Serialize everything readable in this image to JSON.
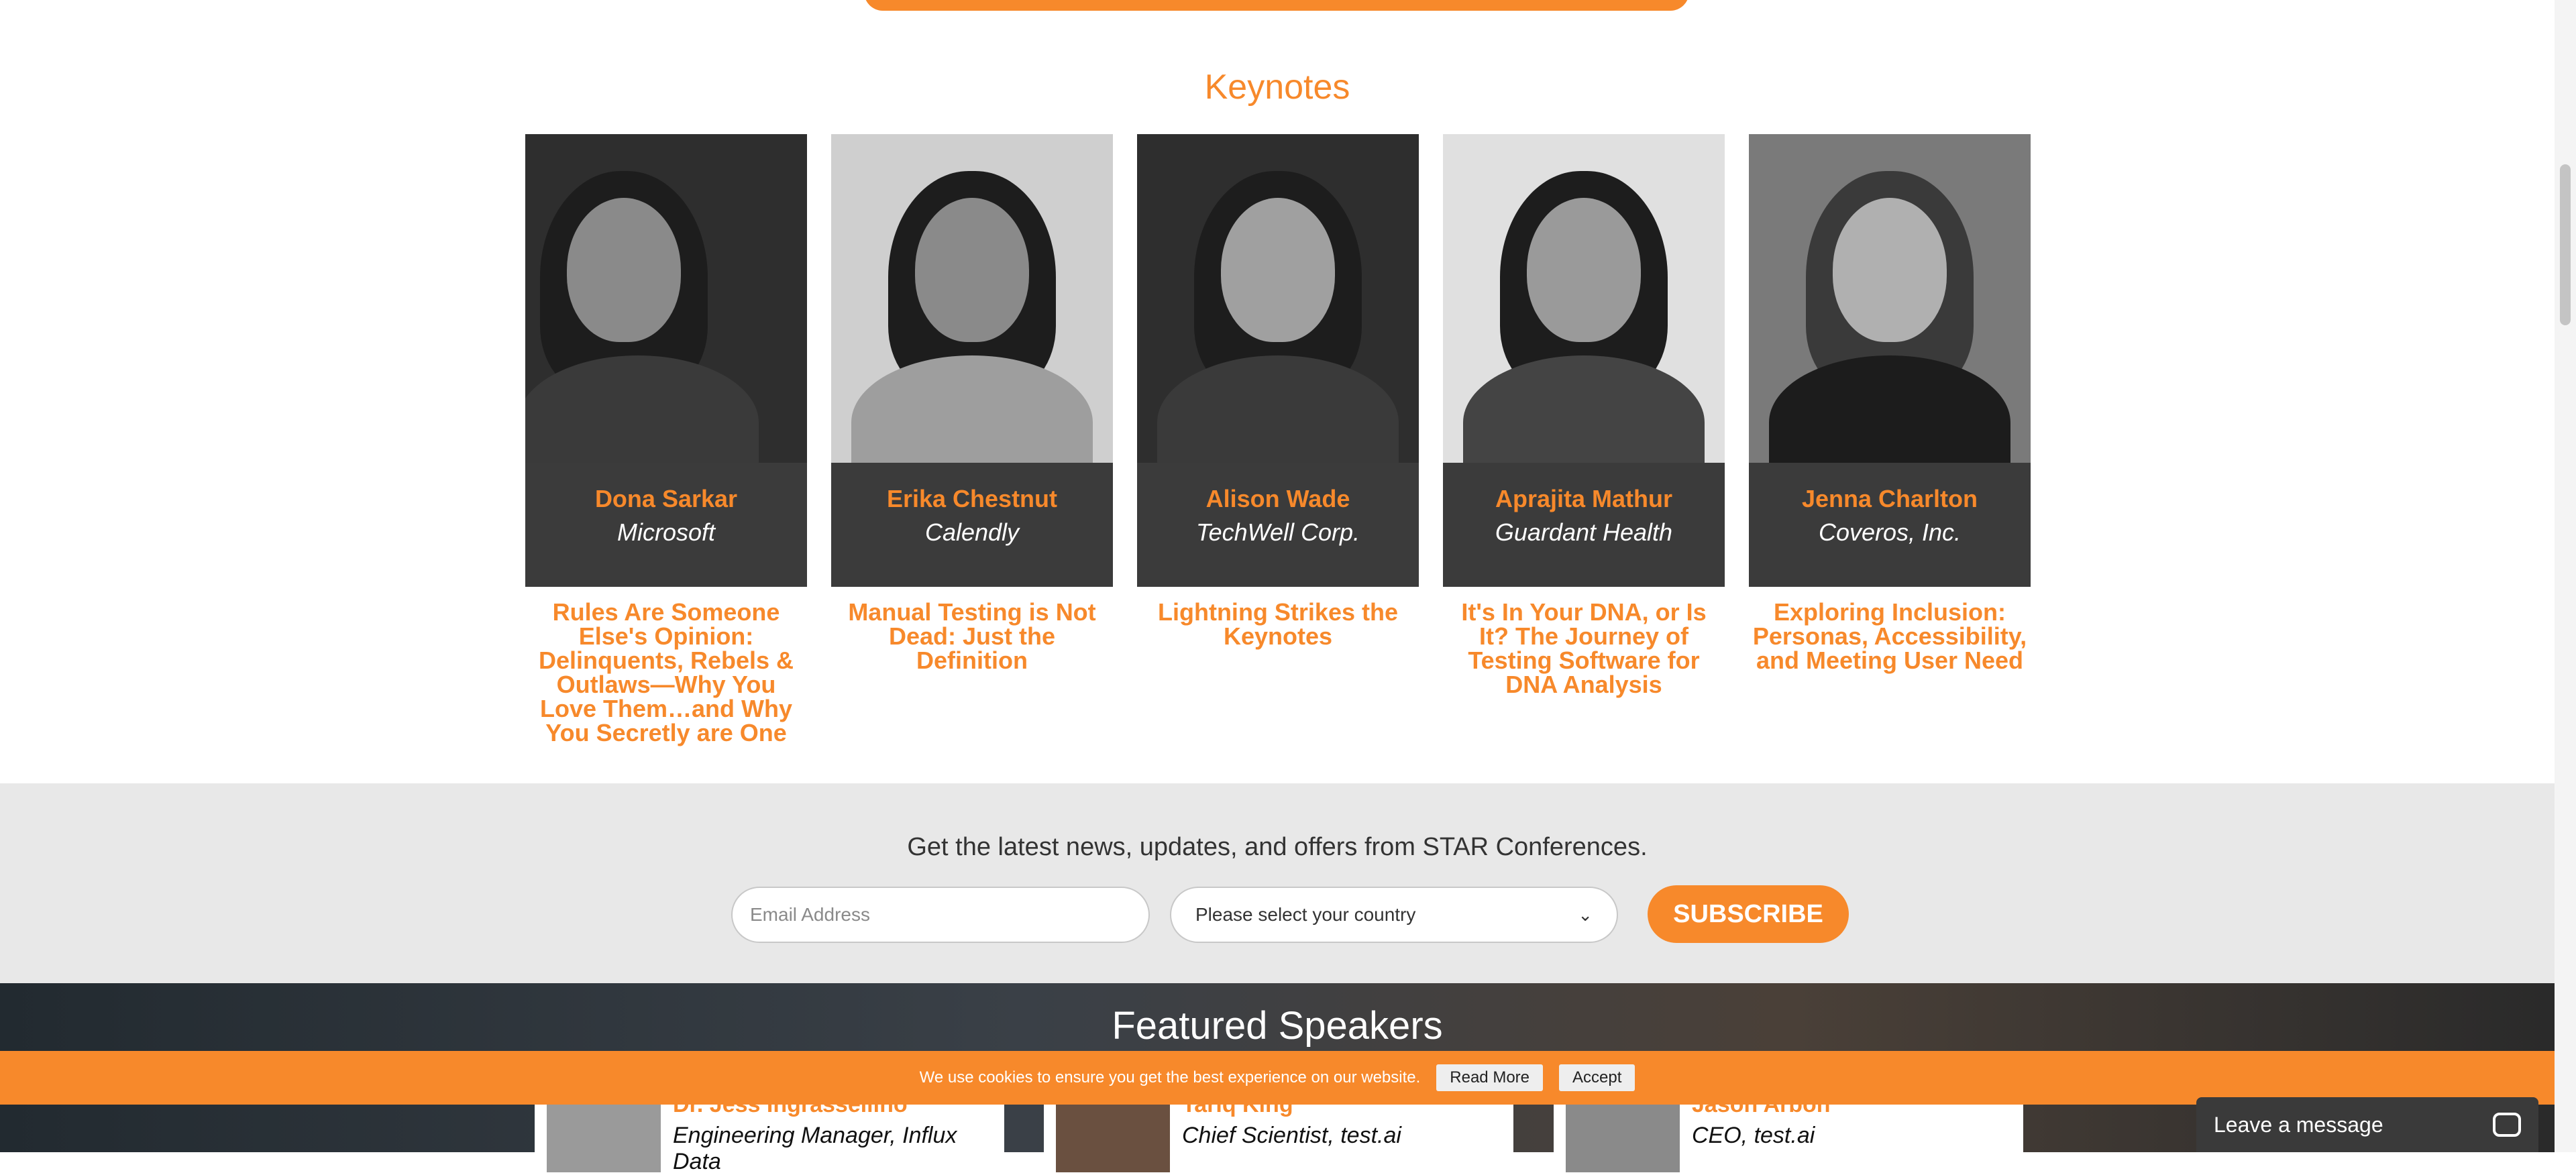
{
  "keynotes": {
    "title": "Keynotes",
    "speakers": [
      {
        "name": "Dona Sarkar",
        "company": "Microsoft",
        "talk": "Rules Are Someone Else's Opinion: Delinquents, Rebels & Outlaws—Why You Love Them…and Why You Secretly are One"
      },
      {
        "name": "Erika Chestnut",
        "company": "Calendly",
        "talk": "Manual Testing is Not Dead: Just the Definition"
      },
      {
        "name": "Alison Wade",
        "company": "TechWell Corp.",
        "talk": "Lightning Strikes the Keynotes"
      },
      {
        "name": "Aprajita Mathur",
        "company": "Guardant Health",
        "talk": "It's In Your DNA, or Is It? The Journey of Testing Software for DNA Analysis"
      },
      {
        "name": "Jenna Charlton",
        "company": "Coveros, Inc.",
        "talk": "Exploring Inclusion: Personas, Accessibility, and Meeting User Need"
      }
    ]
  },
  "newsletter": {
    "text": "Get the latest news, updates, and offers from STAR Conferences.",
    "email_placeholder": "Email Address",
    "country_value": "Please select your country",
    "subscribe_label": "SUBSCRIBE"
  },
  "featured": {
    "title": "Featured Speakers",
    "speakers": [
      {
        "name": "Dr. Jess Ingrassellino",
        "role": "Engineering Manager, Influx Data"
      },
      {
        "name": "Tariq King",
        "role": "Chief Scientist, test.ai"
      },
      {
        "name": "Jason Arbon",
        "role": "CEO, test.ai"
      }
    ]
  },
  "cookie": {
    "text": "We use cookies to ensure you get the best experience on our website.",
    "read_more": "Read More",
    "accept": "Accept"
  },
  "chat": {
    "label": "Leave a message"
  },
  "colors": {
    "accent": "#f7892b",
    "card_dark": "#3b3b3b",
    "band": "#e8e8e8"
  }
}
